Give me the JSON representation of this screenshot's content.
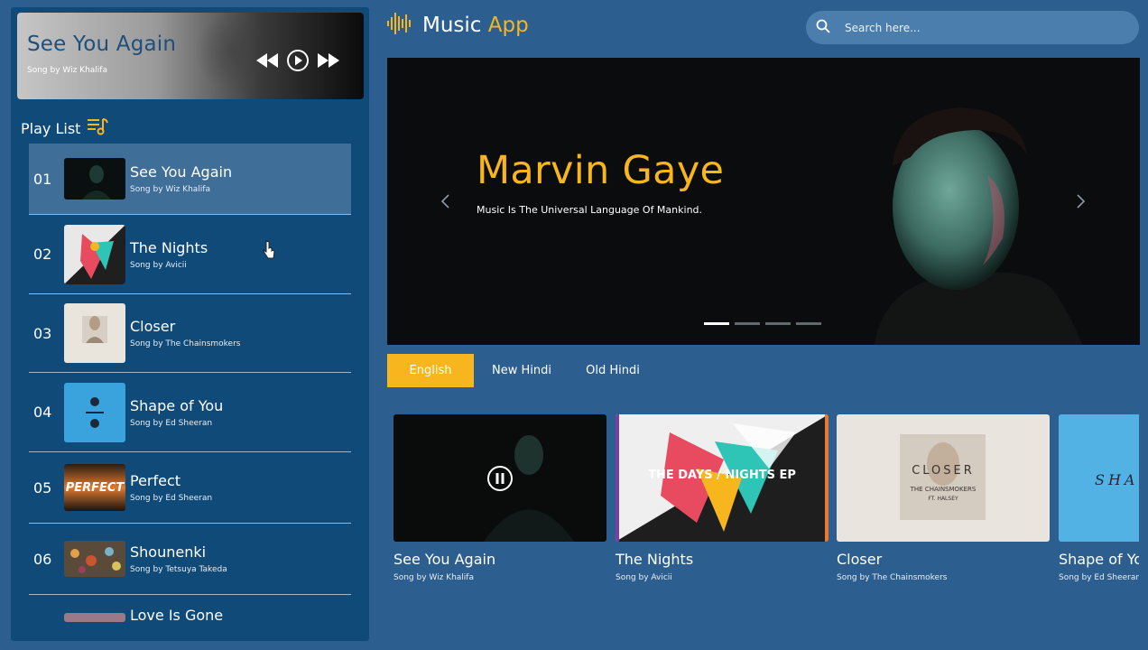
{
  "now_playing": {
    "title": "See You Again",
    "artist": "Song by Wiz Khalifa",
    "controls": [
      "rewind-icon",
      "play-icon",
      "fast-forward-icon"
    ]
  },
  "playlist": {
    "title": "Play List",
    "icon": "playlist-music-icon",
    "items": [
      {
        "num": "01",
        "name": "See You Again",
        "artist": "Song by Wiz Khalifa"
      },
      {
        "num": "02",
        "name": "The Nights",
        "artist": "Song by Avicii"
      },
      {
        "num": "03",
        "name": "Closer",
        "artist": "Song by The Chainsmokers"
      },
      {
        "num": "04",
        "name": "Shape of You",
        "artist": "Song by Ed Sheeran"
      },
      {
        "num": "05",
        "name": "Perfect",
        "artist": "Song by Ed Sheeran"
      },
      {
        "num": "06",
        "name": "Shounenki",
        "artist": "Song by Tetsuya Takeda"
      },
      {
        "num": "",
        "name": "Love Is Gone",
        "artist": ""
      }
    ]
  },
  "header": {
    "brand_main": "Music ",
    "brand_accent": "App",
    "search_placeholder": "Search here..."
  },
  "hero": {
    "title": "Marvin Gaye",
    "subtitle": "Music Is The Universal Language Of Mankind.",
    "slides_total": 4,
    "active_slide": 1
  },
  "tabs": [
    {
      "label": "English",
      "active": true
    },
    {
      "label": "New Hindi",
      "active": false
    },
    {
      "label": "Old Hindi",
      "active": false
    }
  ],
  "cards": [
    {
      "name": "See You Again",
      "artist": "Song by Wiz Khalifa"
    },
    {
      "name": "The Nights",
      "artist": "Song by Avicii"
    },
    {
      "name": "Closer",
      "artist": "Song by The Chainsmokers"
    },
    {
      "name": "Shape of You",
      "artist": "Song by Ed Sheeran"
    }
  ],
  "album_text": {
    "nights": "THE DAYS / NIGHTS EP",
    "closer": "CLOSER",
    "closer_sub": "THE CHAINSMOKERS",
    "closer_feat": "FT. HALSEY",
    "perfect": "PERFECT",
    "shape": "SHA"
  },
  "colors": {
    "accent": "#f7b51e",
    "background": "#2c5f8f",
    "panel": "#0f4a79",
    "active_row": "#3f6e99"
  }
}
